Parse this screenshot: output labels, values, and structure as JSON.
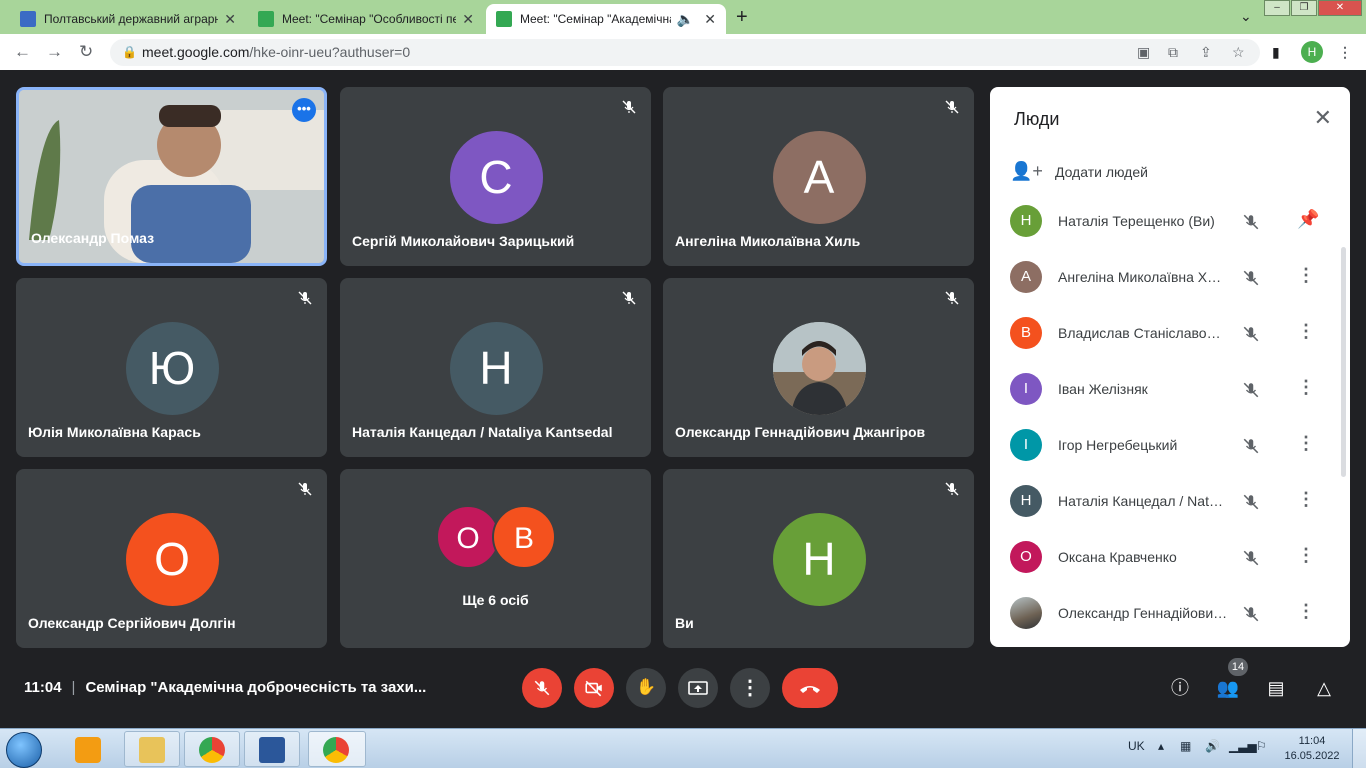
{
  "browser": {
    "tabs": [
      {
        "title": "Полтавський державний аграрн",
        "favicon_color": "#3b6bc4"
      },
      {
        "title": "Meet: \"Семінар \"Особливості пе",
        "favicon_color": "#34a853"
      },
      {
        "title": "Meet: \"Семінар \"Академічна",
        "favicon_color": "#34a853",
        "active": true
      }
    ],
    "url_host": "meet.google.com",
    "url_rest": "/hke-oinr-ueu?authuser=0",
    "profile_initial": "Н"
  },
  "grid": {
    "tiles": [
      {
        "name": "Олександр Помаз",
        "type": "video"
      },
      {
        "name": "Сергій Миколайович Зарицький",
        "initial": "С",
        "color": "#7e57c2"
      },
      {
        "name": "Ангеліна Миколаївна Хиль",
        "initial": "А",
        "color": "#8d6e63"
      },
      {
        "name": "Юлія Миколаївна Карась",
        "initial": "Ю",
        "color": "#455a64"
      },
      {
        "name": "Наталія Канцедал / Nataliya Kantsedal",
        "initial": "Н",
        "color": "#455a64"
      },
      {
        "name": "Олександр Геннадійович Джангіров",
        "type": "photo"
      },
      {
        "name": "Олександр Сергійович Долгін",
        "initial": "О",
        "color": "#f4511e"
      },
      {
        "more_label": "Ще 6 осіб",
        "initials": [
          "О",
          "В"
        ],
        "colors": [
          "#c2185b",
          "#f4511e"
        ]
      },
      {
        "name": "Ви",
        "initial": "Н",
        "color": "#689f38"
      }
    ]
  },
  "people_panel": {
    "title": "Люди",
    "add_label": "Додати людей",
    "participants": [
      {
        "name": "Наталія Терещенко (Ви)",
        "initial": "Н",
        "color": "#689f38"
      },
      {
        "name": "Ангеліна Миколаївна Хиль",
        "initial": "А",
        "color": "#8d6e63"
      },
      {
        "name": "Владислав Станіславович",
        "initial": "В",
        "color": "#f4511e"
      },
      {
        "name": "Іван Желізняк",
        "initial": "І",
        "color": "#7e57c2"
      },
      {
        "name": "Ігор Негребецький",
        "initial": "І",
        "color": "#0097a7"
      },
      {
        "name": "Наталія Канцедал / Nataliya Kantsedal",
        "initial": "Н",
        "color": "#455a64"
      },
      {
        "name": "Оксана Кравченко",
        "initial": "О",
        "color": "#c2185b"
      },
      {
        "name": "Олександр Геннадійович Джангіров",
        "initial": "",
        "color": "#6e6254"
      }
    ]
  },
  "bottom": {
    "time": "11:04",
    "meeting_title": "Семінар \"Академічна доброчесність та захи...",
    "people_count": "14"
  },
  "taskbar": {
    "lang": "UK",
    "clock_time": "11:04",
    "clock_date": "16.05.2022"
  }
}
